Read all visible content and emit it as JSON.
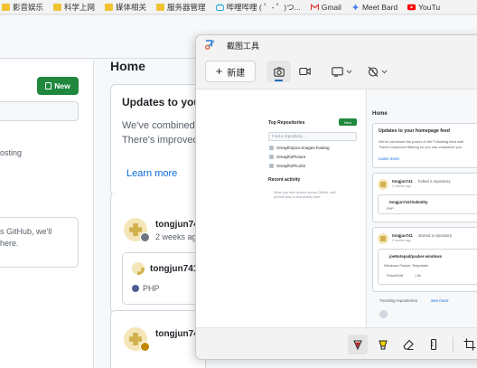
{
  "bookmarks": [
    {
      "label": "影音娱乐",
      "icon": "folder-icon"
    },
    {
      "label": "科学上网",
      "icon": "folder-icon"
    },
    {
      "label": "媒体相关",
      "icon": "folder-icon"
    },
    {
      "label": "服务器管理",
      "icon": "folder-icon"
    },
    {
      "label": "哔哩哔哩 ( ゜- ゜)つ...",
      "icon": "bilibili-icon"
    },
    {
      "label": "Gmail",
      "icon": "gmail-icon"
    },
    {
      "label": "Meet Bard",
      "icon": "bard-icon"
    },
    {
      "label": "YouTu",
      "icon": "youtube-icon"
    }
  ],
  "github": {
    "new_label": "New",
    "left_text_1": "osting",
    "left_text_2": "s GitHub, we'll",
    "left_text_3": "here.",
    "home_title": "Home",
    "updates_title": "Updates to your homepage feed",
    "updates_line1": "We've combined the power of the Following feed",
    "updates_line2": "There's improved filtering so you can customize",
    "learn_more": "Learn more",
    "activity1_user": "tongjun741",
    "activity1_time": "2 weeks ago",
    "repo_name": "tongjun741/Submitty",
    "repo_lang": "PHP",
    "activity2_user": "tongjun741"
  },
  "snip": {
    "title": "截图工具",
    "new_label": "新建",
    "shot": {
      "top_repos": "Top Repositories",
      "new": "New",
      "find_repo": "Find a repository...",
      "repos": [
        "Oreaylfu/pico-images-hosting",
        "Oreaylfu/Picture",
        "Oreaylfu/Pic202"
      ],
      "recent": "Recent activity",
      "recent_text_1": "When you take actions across GitHub, we'll",
      "recent_text_2": "provide links to that activity here.",
      "home": "Home",
      "updates_title": "Updates to your homepage feed",
      "updates_line1": "We've combined the power of the Following feed with",
      "updates_line2": "There's improved filtering so you can customize you",
      "learn_more": "Learn more",
      "a1_user": "tongjun741",
      "a1_action": "forked a repository",
      "a1_time": "2 weeks ago",
      "a1_repo": "tongjun741/Submitty",
      "a1_lang": "PHP",
      "a2_user": "tongjun741",
      "a2_action": "starred a repository",
      "a2_time": "2 weeks ago",
      "a2_repo": "joeNotepad/packer-windows",
      "a2_desc": "Windows Packer Templates",
      "a2_lang": "PowerShell",
      "a2_stars": "1.6k",
      "trending": "Trending repositories",
      "see_more": "See more"
    }
  },
  "colors": {
    "github_green": "#1f883d",
    "link_blue": "#0969da",
    "snip_accent": "#1a67b8",
    "php_lang": "#4F5D95"
  }
}
